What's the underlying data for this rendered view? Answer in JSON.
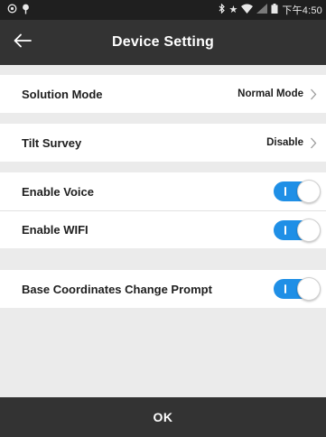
{
  "status_bar": {
    "left_icons": [
      "camera-icon",
      "location-pin-icon"
    ],
    "right_icons": [
      "bluetooth-icon",
      "star-icon",
      "signal-icon",
      "no-signal-icon",
      "battery-icon"
    ],
    "time": "下午4:50"
  },
  "app_bar": {
    "title": "Device Setting",
    "back_icon": "arrow-left-icon"
  },
  "settings": {
    "solution_mode": {
      "label": "Solution Mode",
      "value": "Normal Mode"
    },
    "tilt_survey": {
      "label": "Tilt Survey",
      "value": "Disable"
    },
    "enable_voice": {
      "label": "Enable Voice",
      "on": true
    },
    "enable_wifi": {
      "label": "Enable WIFI",
      "on": true
    },
    "base_coordinates_prompt": {
      "label": "Base Coordinates Change Prompt",
      "on": true
    }
  },
  "footer": {
    "ok_label": "OK"
  },
  "colors": {
    "header_bg": "#333333",
    "status_bar_bg": "#1f1f1f",
    "background": "#ebebeb",
    "toggle_on": "#1f8fe6"
  }
}
